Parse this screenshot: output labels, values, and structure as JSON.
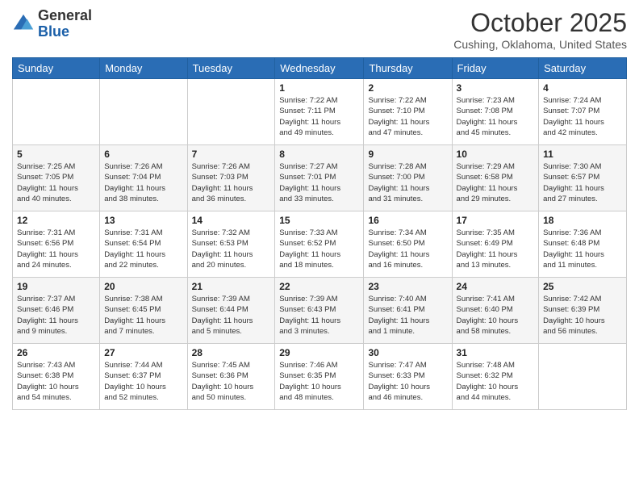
{
  "header": {
    "logo_general": "General",
    "logo_blue": "Blue",
    "month_title": "October 2025",
    "location": "Cushing, Oklahoma, United States"
  },
  "days_of_week": [
    "Sunday",
    "Monday",
    "Tuesday",
    "Wednesday",
    "Thursday",
    "Friday",
    "Saturday"
  ],
  "weeks": [
    [
      {
        "day": "",
        "info": ""
      },
      {
        "day": "",
        "info": ""
      },
      {
        "day": "",
        "info": ""
      },
      {
        "day": "1",
        "info": "Sunrise: 7:22 AM\nSunset: 7:11 PM\nDaylight: 11 hours\nand 49 minutes."
      },
      {
        "day": "2",
        "info": "Sunrise: 7:22 AM\nSunset: 7:10 PM\nDaylight: 11 hours\nand 47 minutes."
      },
      {
        "day": "3",
        "info": "Sunrise: 7:23 AM\nSunset: 7:08 PM\nDaylight: 11 hours\nand 45 minutes."
      },
      {
        "day": "4",
        "info": "Sunrise: 7:24 AM\nSunset: 7:07 PM\nDaylight: 11 hours\nand 42 minutes."
      }
    ],
    [
      {
        "day": "5",
        "info": "Sunrise: 7:25 AM\nSunset: 7:05 PM\nDaylight: 11 hours\nand 40 minutes."
      },
      {
        "day": "6",
        "info": "Sunrise: 7:26 AM\nSunset: 7:04 PM\nDaylight: 11 hours\nand 38 minutes."
      },
      {
        "day": "7",
        "info": "Sunrise: 7:26 AM\nSunset: 7:03 PM\nDaylight: 11 hours\nand 36 minutes."
      },
      {
        "day": "8",
        "info": "Sunrise: 7:27 AM\nSunset: 7:01 PM\nDaylight: 11 hours\nand 33 minutes."
      },
      {
        "day": "9",
        "info": "Sunrise: 7:28 AM\nSunset: 7:00 PM\nDaylight: 11 hours\nand 31 minutes."
      },
      {
        "day": "10",
        "info": "Sunrise: 7:29 AM\nSunset: 6:58 PM\nDaylight: 11 hours\nand 29 minutes."
      },
      {
        "day": "11",
        "info": "Sunrise: 7:30 AM\nSunset: 6:57 PM\nDaylight: 11 hours\nand 27 minutes."
      }
    ],
    [
      {
        "day": "12",
        "info": "Sunrise: 7:31 AM\nSunset: 6:56 PM\nDaylight: 11 hours\nand 24 minutes."
      },
      {
        "day": "13",
        "info": "Sunrise: 7:31 AM\nSunset: 6:54 PM\nDaylight: 11 hours\nand 22 minutes."
      },
      {
        "day": "14",
        "info": "Sunrise: 7:32 AM\nSunset: 6:53 PM\nDaylight: 11 hours\nand 20 minutes."
      },
      {
        "day": "15",
        "info": "Sunrise: 7:33 AM\nSunset: 6:52 PM\nDaylight: 11 hours\nand 18 minutes."
      },
      {
        "day": "16",
        "info": "Sunrise: 7:34 AM\nSunset: 6:50 PM\nDaylight: 11 hours\nand 16 minutes."
      },
      {
        "day": "17",
        "info": "Sunrise: 7:35 AM\nSunset: 6:49 PM\nDaylight: 11 hours\nand 13 minutes."
      },
      {
        "day": "18",
        "info": "Sunrise: 7:36 AM\nSunset: 6:48 PM\nDaylight: 11 hours\nand 11 minutes."
      }
    ],
    [
      {
        "day": "19",
        "info": "Sunrise: 7:37 AM\nSunset: 6:46 PM\nDaylight: 11 hours\nand 9 minutes."
      },
      {
        "day": "20",
        "info": "Sunrise: 7:38 AM\nSunset: 6:45 PM\nDaylight: 11 hours\nand 7 minutes."
      },
      {
        "day": "21",
        "info": "Sunrise: 7:39 AM\nSunset: 6:44 PM\nDaylight: 11 hours\nand 5 minutes."
      },
      {
        "day": "22",
        "info": "Sunrise: 7:39 AM\nSunset: 6:43 PM\nDaylight: 11 hours\nand 3 minutes."
      },
      {
        "day": "23",
        "info": "Sunrise: 7:40 AM\nSunset: 6:41 PM\nDaylight: 11 hours\nand 1 minute."
      },
      {
        "day": "24",
        "info": "Sunrise: 7:41 AM\nSunset: 6:40 PM\nDaylight: 10 hours\nand 58 minutes."
      },
      {
        "day": "25",
        "info": "Sunrise: 7:42 AM\nSunset: 6:39 PM\nDaylight: 10 hours\nand 56 minutes."
      }
    ],
    [
      {
        "day": "26",
        "info": "Sunrise: 7:43 AM\nSunset: 6:38 PM\nDaylight: 10 hours\nand 54 minutes."
      },
      {
        "day": "27",
        "info": "Sunrise: 7:44 AM\nSunset: 6:37 PM\nDaylight: 10 hours\nand 52 minutes."
      },
      {
        "day": "28",
        "info": "Sunrise: 7:45 AM\nSunset: 6:36 PM\nDaylight: 10 hours\nand 50 minutes."
      },
      {
        "day": "29",
        "info": "Sunrise: 7:46 AM\nSunset: 6:35 PM\nDaylight: 10 hours\nand 48 minutes."
      },
      {
        "day": "30",
        "info": "Sunrise: 7:47 AM\nSunset: 6:33 PM\nDaylight: 10 hours\nand 46 minutes."
      },
      {
        "day": "31",
        "info": "Sunrise: 7:48 AM\nSunset: 6:32 PM\nDaylight: 10 hours\nand 44 minutes."
      },
      {
        "day": "",
        "info": ""
      }
    ]
  ]
}
